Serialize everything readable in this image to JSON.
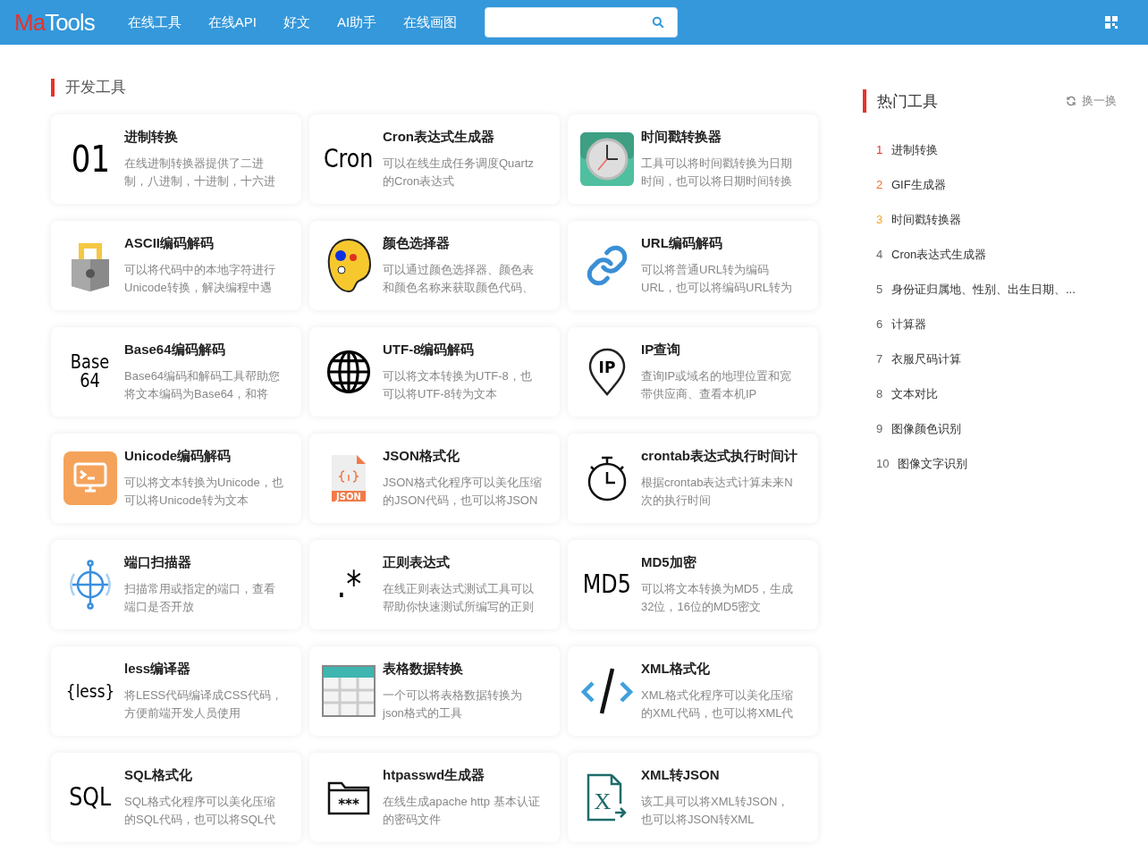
{
  "header": {
    "logo_accent": "Ma",
    "logo_rest": "Tools",
    "nav": [
      {
        "label": "在线工具"
      },
      {
        "label": "在线API"
      },
      {
        "label": "好文"
      },
      {
        "label": "AI助手"
      },
      {
        "label": "在线画图"
      }
    ]
  },
  "section": {
    "title": "开发工具",
    "cards": [
      {
        "title": "进制转换",
        "desc": "在线进制转换器提供了二进制，八进制，十进制，十六进",
        "icon": {
          "kind": "text",
          "text": "01"
        }
      },
      {
        "title": "Cron表达式生成器",
        "desc": "可以在线生成任务调度Quartz的Cron表达式",
        "icon": {
          "kind": "text",
          "text": "Cron"
        }
      },
      {
        "title": "时间戳转换器",
        "desc": "工具可以将时间戳转换为日期时间，也可以将日期时间转换",
        "icon": {
          "kind": "clock"
        }
      },
      {
        "title": "ASCII编码解码",
        "desc": "可以将代码中的本地字符进行Unicode转换，解决编程中遇",
        "icon": {
          "kind": "lock"
        }
      },
      {
        "title": "颜色选择器",
        "desc": "可以通过颜色选择器、颜色表和颜色名称来获取颜色代码、",
        "icon": {
          "kind": "palette"
        }
      },
      {
        "title": "URL编码解码",
        "desc": "可以将普通URL转为编码URL，也可以将编码URL转为",
        "icon": {
          "kind": "link"
        }
      },
      {
        "title": "Base64编码解码",
        "desc": "Base64编码和解码工具帮助您将文本编码为Base64，和将",
        "icon": {
          "kind": "text",
          "text": "Base 64"
        }
      },
      {
        "title": "UTF-8编码解码",
        "desc": "可以将文本转换为UTF-8，也可以将UTF-8转为文本",
        "icon": {
          "kind": "globe"
        }
      },
      {
        "title": "IP查询",
        "desc": "查询IP或域名的地理位置和宽带供应商、查看本机IP",
        "icon": {
          "kind": "pin",
          "text": "IP"
        }
      },
      {
        "title": "Unicode编码解码",
        "desc": "可以将文本转换为Unicode，也可以将Unicode转为文本",
        "icon": {
          "kind": "monitor"
        }
      },
      {
        "title": "JSON格式化",
        "desc": "JSON格式化程序可以美化压缩的JSON代码，也可以将JSON",
        "icon": {
          "kind": "file",
          "text": "JSON"
        }
      },
      {
        "title": "crontab表达式执行时间计",
        "desc": "根据crontab表达式计算未来N次的执行时间",
        "icon": {
          "kind": "stopwatch"
        }
      },
      {
        "title": "端口扫描器",
        "desc": "扫描常用或指定的端口，查看端口是否开放",
        "icon": {
          "kind": "target"
        }
      },
      {
        "title": "正则表达式",
        "desc": "在线正则表达式测试工具可以帮助你快速测试所编写的正则",
        "icon": {
          "kind": "text",
          "text": ".*"
        }
      },
      {
        "title": "MD5加密",
        "desc": "可以将文本转换为MD5，生成32位，16位的MD5密文",
        "icon": {
          "kind": "text",
          "text": "MD5"
        }
      },
      {
        "title": "less编译器",
        "desc": "将LESS代码编译成CSS代码，方便前端开发人员使用",
        "icon": {
          "kind": "text",
          "text": "{less}"
        }
      },
      {
        "title": "表格数据转换",
        "desc": "一个可以将表格数据转换为json格式的工具",
        "icon": {
          "kind": "table"
        }
      },
      {
        "title": "XML格式化",
        "desc": "XML格式化程序可以美化压缩的XML代码，也可以将XML代",
        "icon": {
          "kind": "code"
        }
      },
      {
        "title": "SQL格式化",
        "desc": "SQL格式化程序可以美化压缩的SQL代码，也可以将SQL代",
        "icon": {
          "kind": "text",
          "text": "SQL"
        }
      },
      {
        "title": "htpasswd生成器",
        "desc": "在线生成apache http 基本认证的密码文件",
        "icon": {
          "kind": "folder",
          "text": "***"
        }
      },
      {
        "title": "XML转JSON",
        "desc": "该工具可以将XML转JSON，也可以将JSON转XML",
        "icon": {
          "kind": "xfile",
          "text": "X"
        }
      }
    ]
  },
  "hot": {
    "title": "热门工具",
    "refresh": "换一换",
    "items": [
      {
        "rank": "1",
        "name": "进制转换",
        "color": "#e8322a"
      },
      {
        "rank": "2",
        "name": "GIF生成器",
        "color": "#f0702a"
      },
      {
        "rank": "3",
        "name": "时间戳转换器",
        "color": "#f5a623"
      },
      {
        "rank": "4",
        "name": "Cron表达式生成器",
        "color": "#666666"
      },
      {
        "rank": "5",
        "name": "身份证归属地、性别、出生日期、...",
        "color": "#666666"
      },
      {
        "rank": "6",
        "name": "计算器",
        "color": "#666666"
      },
      {
        "rank": "7",
        "name": "衣服尺码计算",
        "color": "#666666"
      },
      {
        "rank": "8",
        "name": "文本对比",
        "color": "#666666"
      },
      {
        "rank": "9",
        "name": "图像颜色识别",
        "color": "#666666"
      },
      {
        "rank": "10",
        "name": "图像文字识别",
        "color": "#666666"
      }
    ]
  }
}
